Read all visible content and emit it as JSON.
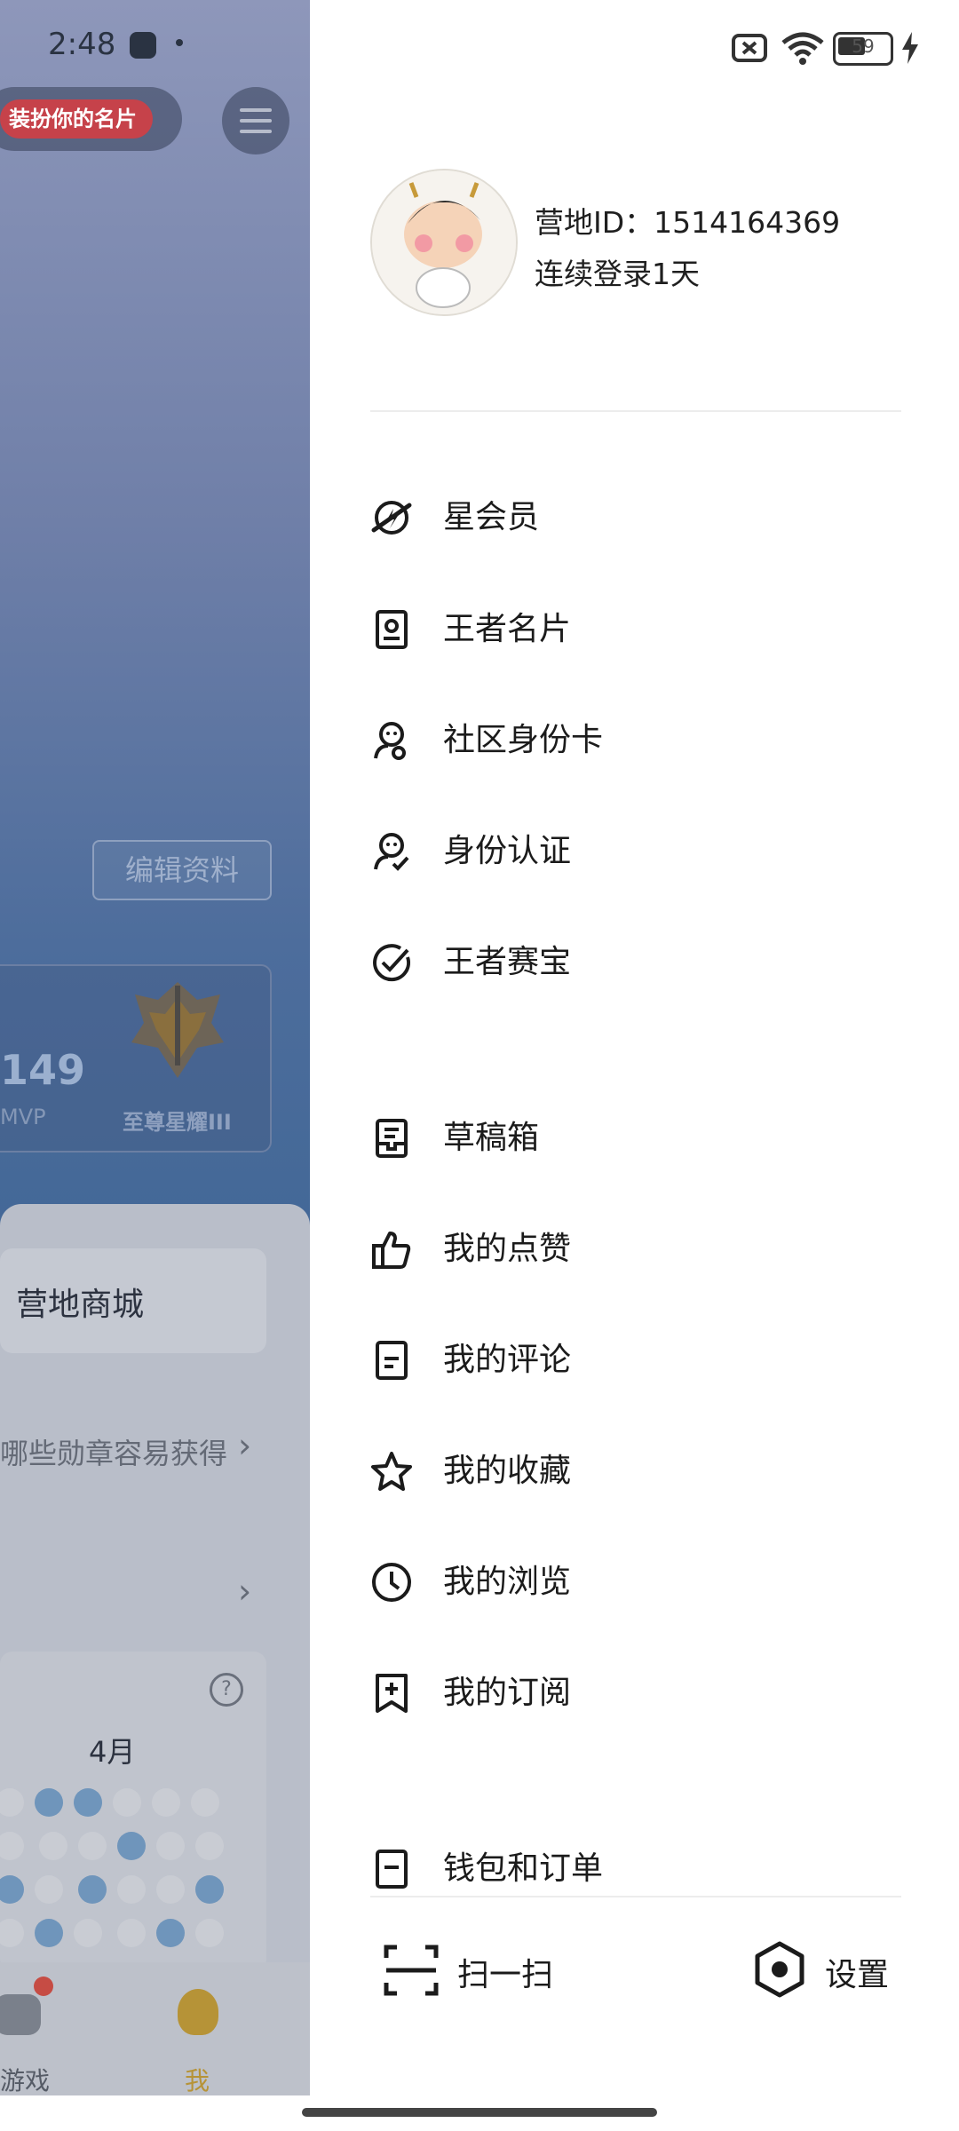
{
  "status_bar": {
    "time": "2:48",
    "battery": "59"
  },
  "background_app": {
    "dress_card_label": "装扮你的名片",
    "edit_profile_label": "编辑资料",
    "stat_value": "149",
    "stat_label": "MVP",
    "rank_label": "至尊星耀III",
    "mall_label": "营地商城",
    "medal_hint": "哪些勋章容易获得",
    "calendar_month": "4月",
    "nav_game_label": "游戏",
    "nav_me_label": "我"
  },
  "drawer": {
    "profile": {
      "id_text": "营地ID：1514164369",
      "login_text": "连续登录1天"
    },
    "menu_group1": [
      {
        "label": "星会员",
        "icon": "star-member-icon"
      },
      {
        "label": "王者名片",
        "icon": "namecard-icon"
      },
      {
        "label": "社区身份卡",
        "icon": "community-id-icon"
      },
      {
        "label": "身份认证",
        "icon": "identity-verify-icon"
      },
      {
        "label": "王者赛宝",
        "icon": "check-circle-icon"
      }
    ],
    "menu_group2": [
      {
        "label": "草稿箱",
        "icon": "drafts-icon"
      },
      {
        "label": "我的点赞",
        "icon": "thumbs-up-icon"
      },
      {
        "label": "我的评论",
        "icon": "comment-doc-icon"
      },
      {
        "label": "我的收藏",
        "icon": "star-icon"
      },
      {
        "label": "我的浏览",
        "icon": "clock-icon"
      },
      {
        "label": "我的订阅",
        "icon": "bookmark-plus-icon"
      },
      {
        "label": "钱包和订单",
        "icon": "wallet-icon"
      }
    ],
    "bottom": {
      "scan_label": "扫一扫",
      "settings_label": "设置"
    }
  },
  "colors": {
    "accent_red": "#c6424a",
    "gold": "#b69337",
    "text": "#1b1b1b"
  }
}
